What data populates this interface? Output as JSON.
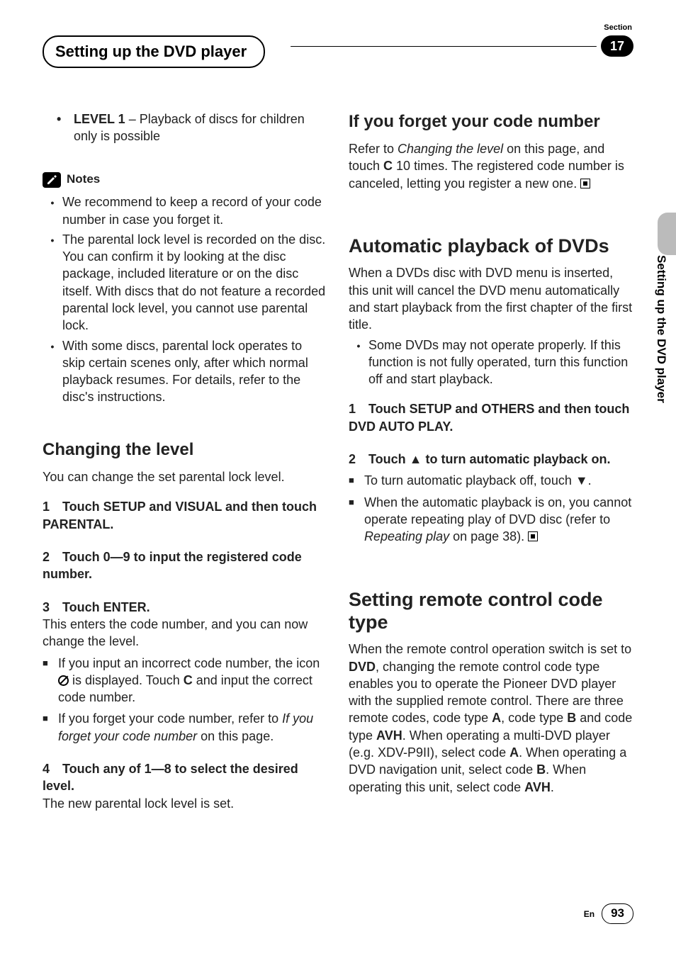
{
  "header": {
    "title": "Setting up the DVD player",
    "section_label": "Section",
    "section_number": "17",
    "side_text": "Setting up the DVD player"
  },
  "left": {
    "level1_bold": "LEVEL 1",
    "level1_rest": " – Playback of discs for children only is possible",
    "notes_label": "Notes",
    "note1": "We recommend to keep a record of your code number in case you forget it.",
    "note2": "The parental lock level is recorded on the disc. You can confirm it by looking at the disc package, included literature or on the disc itself. With discs that do not feature a recorded parental lock level, you cannot use parental lock.",
    "note3": "With some discs, parental lock operates to skip certain scenes only, after which normal playback resumes. For details, refer to the disc's instructions.",
    "h_changing": "Changing the level",
    "changing_intro": "You can change the set parental lock level.",
    "step1": "Touch SETUP and VISUAL and then touch PARENTAL.",
    "step2": "Touch 0—9 to input the registered code number.",
    "step3_label": "Touch ENTER.",
    "step3_body": "This enters the code number, and you can now change the level.",
    "sq1_a": "If you input an incorrect code number, the icon ",
    "sq1_b": " is displayed. Touch ",
    "sq1_c": "C",
    "sq1_d": " and input the correct code number.",
    "sq2_a": "If you forget your code number, refer to ",
    "sq2_b": "If you forget your code number",
    "sq2_c": " on this page.",
    "step4": "Touch any of 1—8 to select the desired level.",
    "step4_body": "The new parental lock level is set."
  },
  "right": {
    "h_forget": "If you forget your code number",
    "forget_a": "Refer to ",
    "forget_b": "Changing the level",
    "forget_c": " on this page, and touch ",
    "forget_d": "C",
    "forget_e": " 10 times. The registered code number is canceled, letting you register a new one.",
    "h_auto": "Automatic playback of DVDs",
    "auto_intro": "When a DVDs disc with DVD menu is inserted, this unit will cancel the DVD menu automatically and start playback from the first chapter of the first title.",
    "auto_bullet": "Some DVDs may not operate properly. If this function is not fully operated, turn this function off and start playback.",
    "auto_step1": "Touch SETUP and OTHERS and then touch DVD AUTO PLAY.",
    "auto_step2": "Touch ▲ to turn automatic playback on.",
    "auto_sq1": "To turn automatic playback off, touch ▼.",
    "auto_sq2_a": "When the automatic playback is on, you cannot operate repeating play of DVD disc (refer to ",
    "auto_sq2_b": "Repeating play",
    "auto_sq2_c": " on page 38).",
    "h_remote": "Setting remote control code type",
    "remote_a": "When the remote control operation switch is set to ",
    "remote_b": "DVD",
    "remote_c": ", changing the remote control code type enables you to operate the Pioneer DVD player with the supplied remote control. There are three remote codes, code type ",
    "remote_d": "A",
    "remote_e": ", code type ",
    "remote_f": "B",
    "remote_g": " and code type ",
    "remote_h": "AVH",
    "remote_i": ". When operating a multi-DVD player (e.g. XDV-P9II), select code ",
    "remote_j": "A",
    "remote_k": ". When operating a DVD navigation unit, select code ",
    "remote_l": "B",
    "remote_m": ". When operating this unit, select code ",
    "remote_n": "AVH",
    "remote_o": "."
  },
  "footer": {
    "lang": "En",
    "page": "93"
  }
}
